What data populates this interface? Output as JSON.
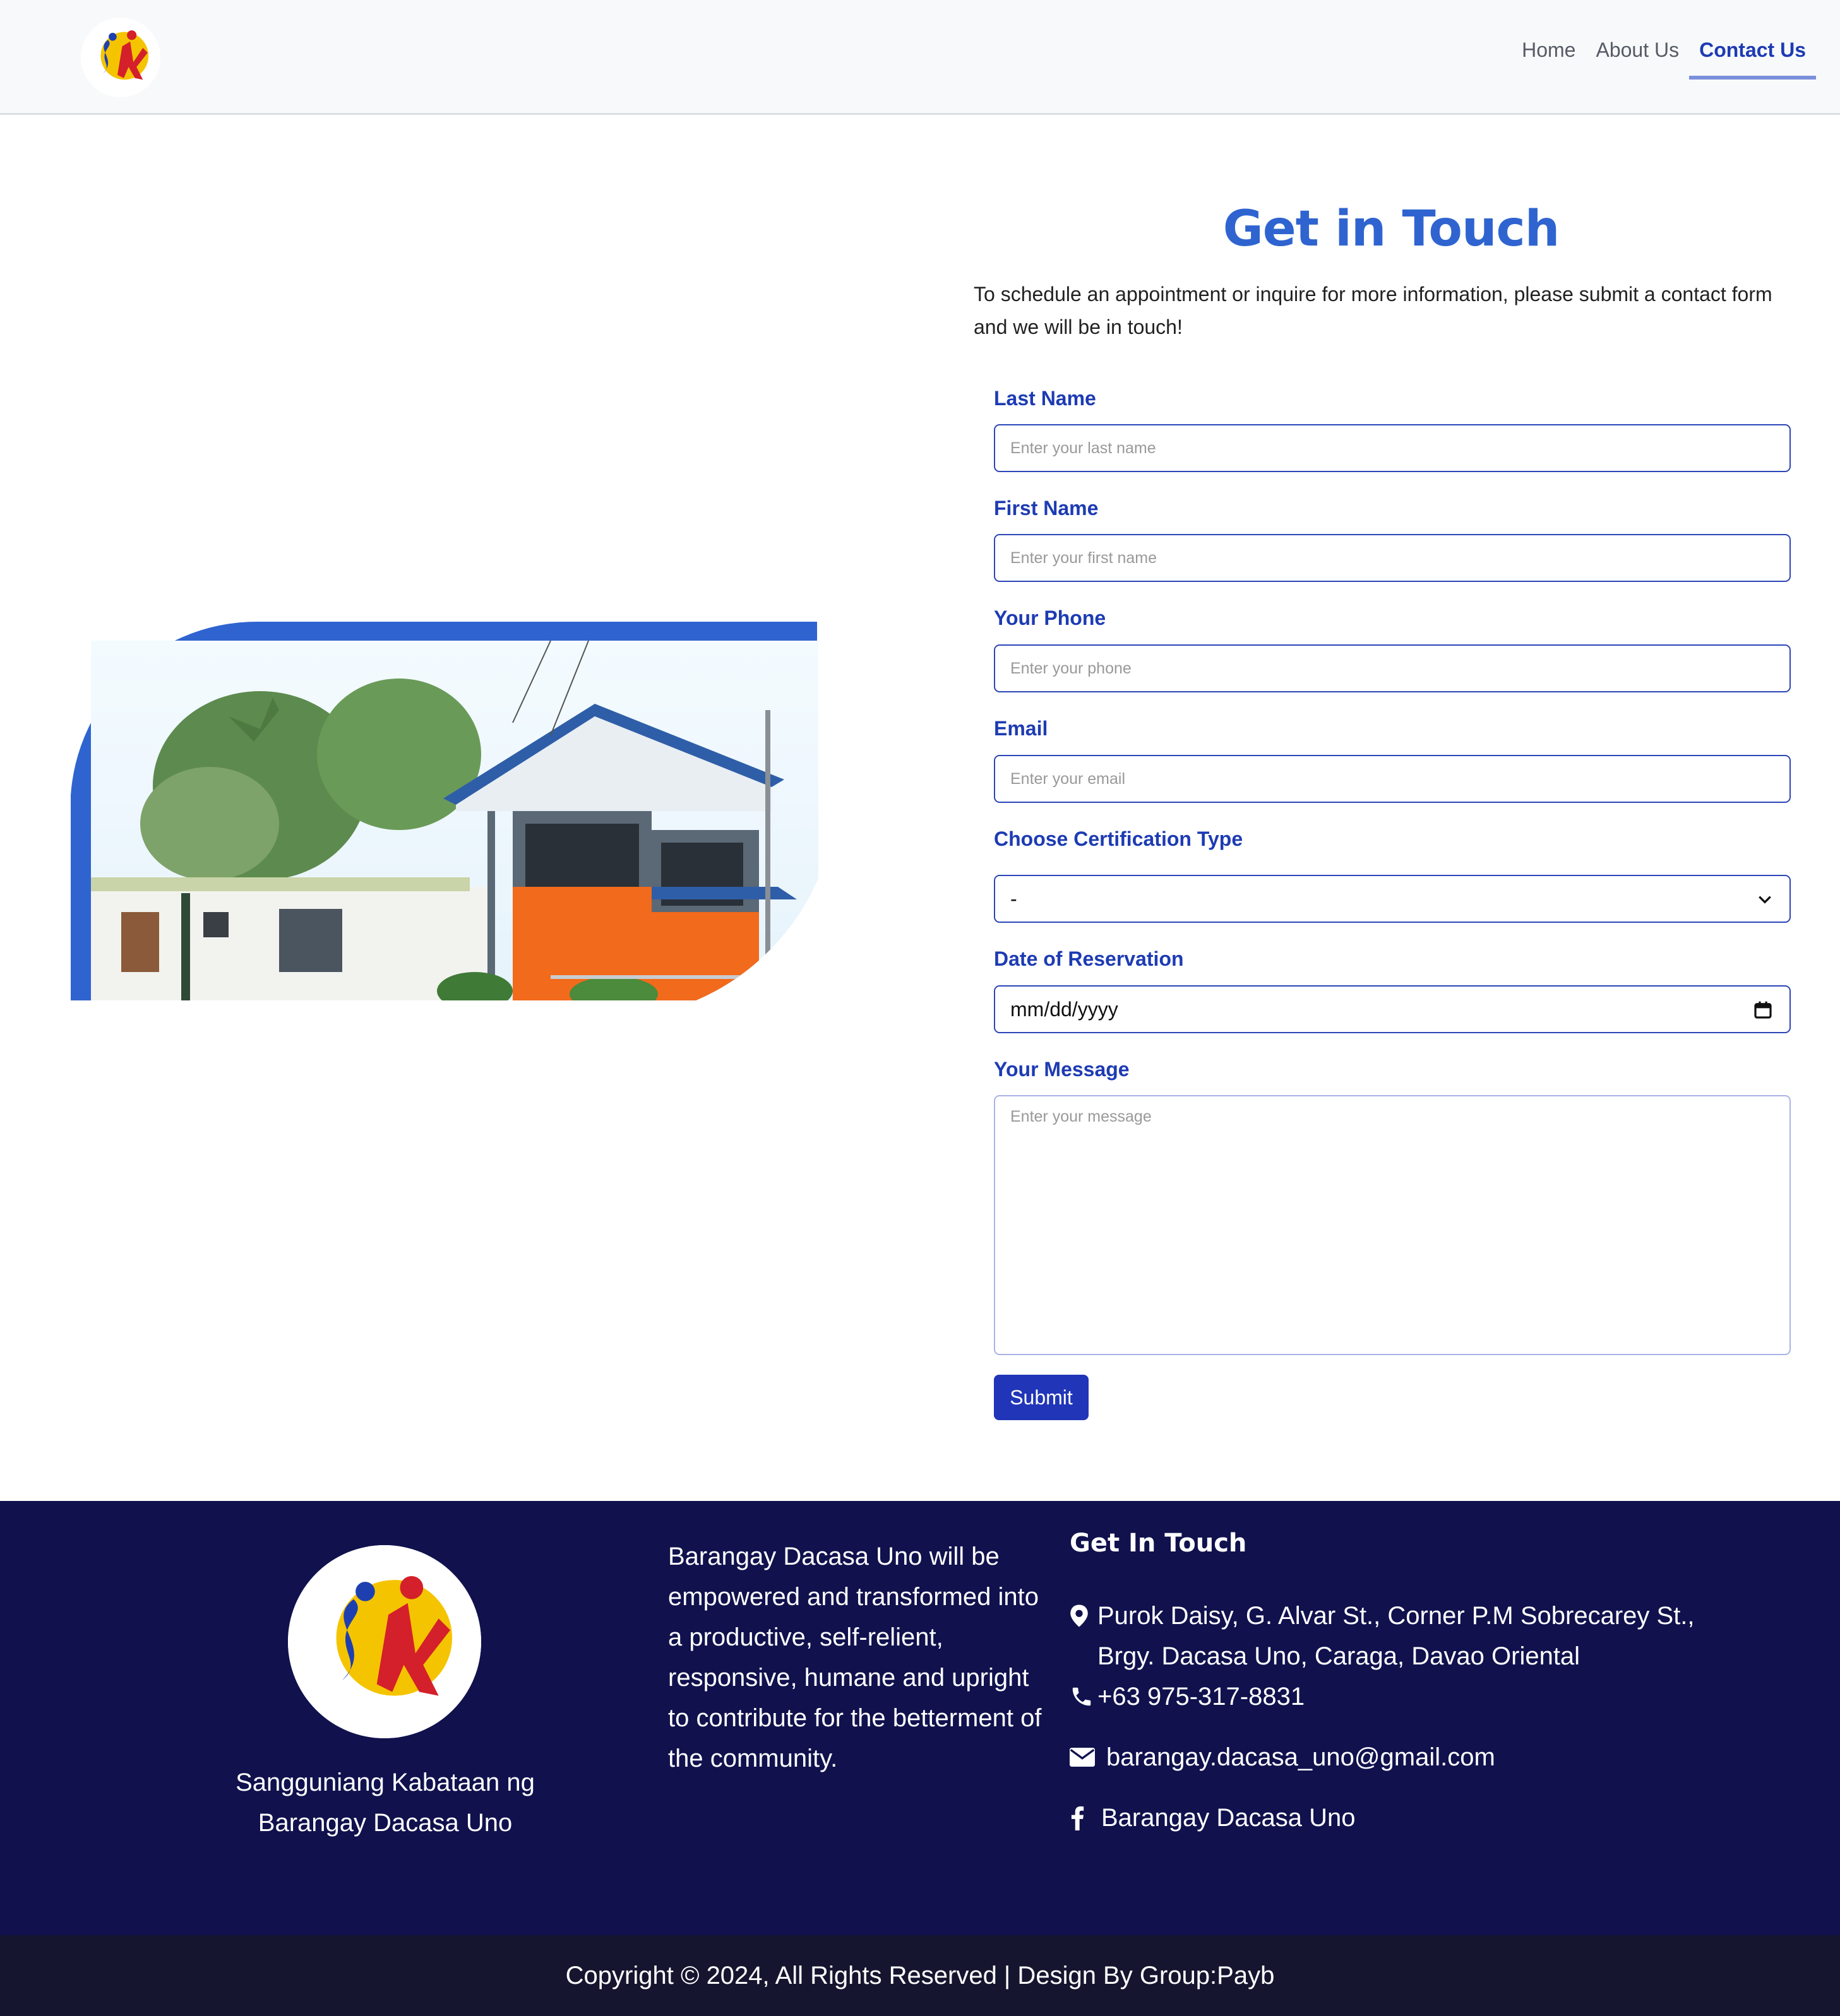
{
  "header": {
    "logo_label": "SK logo",
    "nav": [
      {
        "label": "Home",
        "active": false
      },
      {
        "label": "About Us",
        "active": false
      },
      {
        "label": "Contact Us",
        "active": true
      }
    ]
  },
  "contact": {
    "title": "Get in Touch",
    "intro": "To schedule an appointment or inquire for more information, please submit a contact form and we will be in touch!",
    "fields": {
      "last_name": {
        "label": "Last Name",
        "placeholder": "Enter your last name"
      },
      "first_name": {
        "label": "First Name",
        "placeholder": "Enter your first name"
      },
      "phone": {
        "label": "Your Phone",
        "placeholder": "Enter your phone"
      },
      "email": {
        "label": "Email",
        "placeholder": "Enter your email"
      },
      "certification": {
        "label": "Choose Certification Type",
        "value": "-"
      },
      "date": {
        "label": "Date of Reservation",
        "value": "mm/dd/yyyy"
      },
      "message": {
        "label": "Your Message",
        "placeholder": "Enter your message"
      }
    },
    "submit_label": "Submit"
  },
  "footer": {
    "org_line1": "Sangguniang Kabataan ng",
    "org_line2": "Barangay Dacasa Uno",
    "mission": "Barangay Dacasa Uno will be empowered and transformed into a productive, self-relient, responsive, humane and upright to contribute for the betterment of the community.",
    "heading": "Get In Touch",
    "address_line1": "Purok Daisy, G. Alvar St., Corner P.M Sobrecarey St.,",
    "address_line2": "Brgy. Dacasa Uno, Caraga, Davao Oriental",
    "phone": "+63 975-317-8831",
    "email": "barangay.dacasa_uno@gmail.com",
    "facebook": "Barangay Dacasa Uno",
    "copyright": "Copyright © 2024, All Rights Reserved | Design By Group:Payb"
  },
  "colors": {
    "accent": "#2f64d0",
    "label_blue": "#1d3bb3",
    "button": "#2035b8",
    "footer_bg": "#10114d",
    "copyright_bg": "#15152f"
  },
  "icons": [
    "sk-logo",
    "chevron-down-icon",
    "calendar-icon",
    "map-pin-icon",
    "phone-icon",
    "envelope-icon",
    "facebook-icon"
  ]
}
